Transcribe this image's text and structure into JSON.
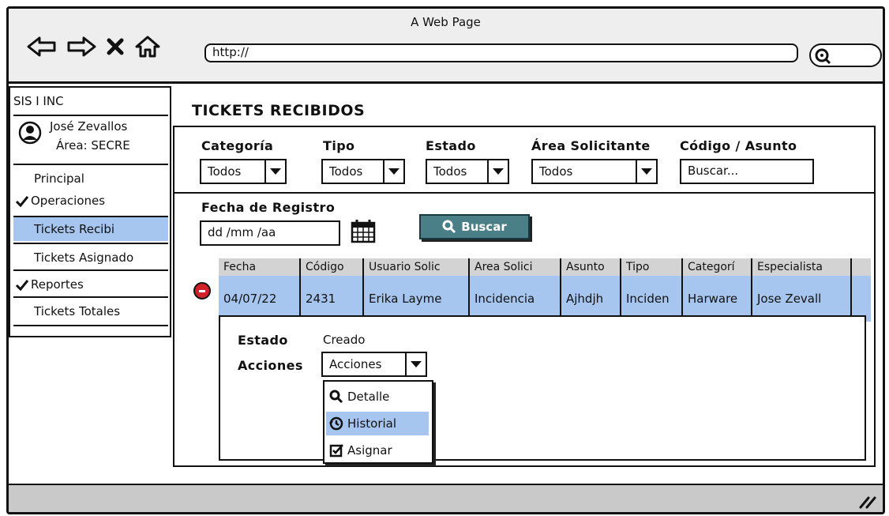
{
  "window": {
    "title": "A Web Page",
    "url": "http://"
  },
  "sidebar": {
    "app_name": "SIS I INC",
    "user_name": "José Zevallos",
    "user_area": "Área: SECRE",
    "items": [
      {
        "label": "Principal",
        "checked": false,
        "active": false
      },
      {
        "label": "Operaciones",
        "checked": true,
        "active": false
      },
      {
        "label": "Tickets Recibi",
        "checked": false,
        "active": true
      },
      {
        "label": "Tickets Asignado",
        "checked": false,
        "active": false
      },
      {
        "label": "Reportes",
        "checked": true,
        "active": false
      },
      {
        "label": "Tickets Totales",
        "checked": false,
        "active": false
      }
    ]
  },
  "page": {
    "title": "TICKETS RECIBIDOS"
  },
  "filters": {
    "categoria": {
      "label": "Categoría",
      "value": "Todos"
    },
    "tipo": {
      "label": "Tipo",
      "value": "Todos"
    },
    "estado": {
      "label": "Estado",
      "value": "Todos"
    },
    "area": {
      "label": "Área Solicitante",
      "value": "Todos"
    },
    "codigo": {
      "label": "Código / Asunto",
      "placeholder": "Buscar..."
    },
    "fecha": {
      "label": "Fecha de Registro",
      "placeholder": "dd  /mm  /aa"
    },
    "search_button": "Buscar"
  },
  "table": {
    "headers": [
      "Fecha",
      "Código",
      "Usuario Solic",
      "Area Solici",
      "Asunto",
      "Tipo",
      "Categorí",
      "Especialista"
    ],
    "rows": [
      [
        "04/07/22",
        "2431",
        "Erika Layme",
        "Incidencia",
        "Ajhdjh",
        "Inciden",
        "Harware",
        "Jose Zevall"
      ]
    ]
  },
  "detail": {
    "estado_label": "Estado",
    "estado_value": "Creado",
    "acciones_label": "Acciones",
    "acciones_select": "Acciones",
    "menu": [
      {
        "label": "Detalle",
        "icon": "search-icon",
        "active": false
      },
      {
        "label": "Historial",
        "icon": "history-icon",
        "active": true
      },
      {
        "label": "Asignar",
        "icon": "checkbox-icon",
        "active": false
      }
    ]
  },
  "colors": {
    "highlight": "#a6c6ef",
    "button": "#4a7f88",
    "toggle": "#d0202a",
    "header": "#d3d3d3"
  }
}
